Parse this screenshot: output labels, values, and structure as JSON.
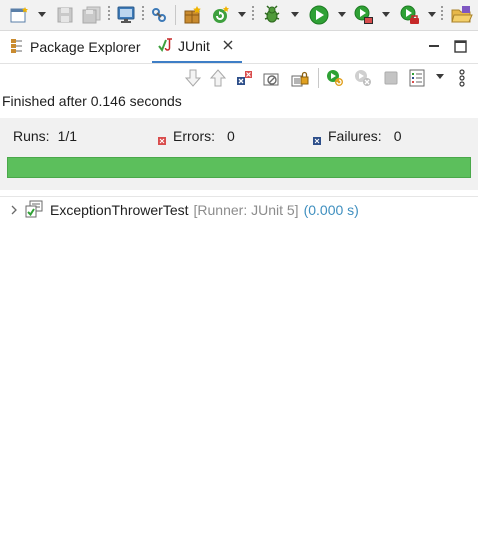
{
  "toolbar": {
    "icons": [
      "new-icon",
      "save-icon",
      "save-all-icon",
      "monitor-icon",
      "link-icon",
      "new-package-icon",
      "refresh-icon",
      "debug-icon",
      "run-icon",
      "run-config-icon",
      "external-tools-icon",
      "open-folder-icon"
    ]
  },
  "tabs": [
    {
      "label": "Package Explorer",
      "icon": "package-explorer-icon",
      "active": false
    },
    {
      "label": "JUnit",
      "icon": "junit-icon",
      "active": true
    }
  ],
  "status": {
    "message": "Finished after 0.146 seconds"
  },
  "counters": {
    "runs_label": "Runs:",
    "runs_value": "1/1",
    "errors_label": "Errors:",
    "errors_value": "0",
    "failures_label": "Failures:",
    "failures_value": "0"
  },
  "progress": {
    "fraction": 1.0,
    "color": "#5cbf5c"
  },
  "tree": {
    "items": [
      {
        "name": "ExceptionThrowerTest",
        "runner": "[Runner: JUnit 5]",
        "time": "(0.000 s)"
      }
    ]
  },
  "colors": {
    "accent": "#3e7ec6",
    "success": "#5cbf5c",
    "error": "#d94d4d",
    "failure": "#2e4f8a",
    "time": "#3f8fbf"
  }
}
